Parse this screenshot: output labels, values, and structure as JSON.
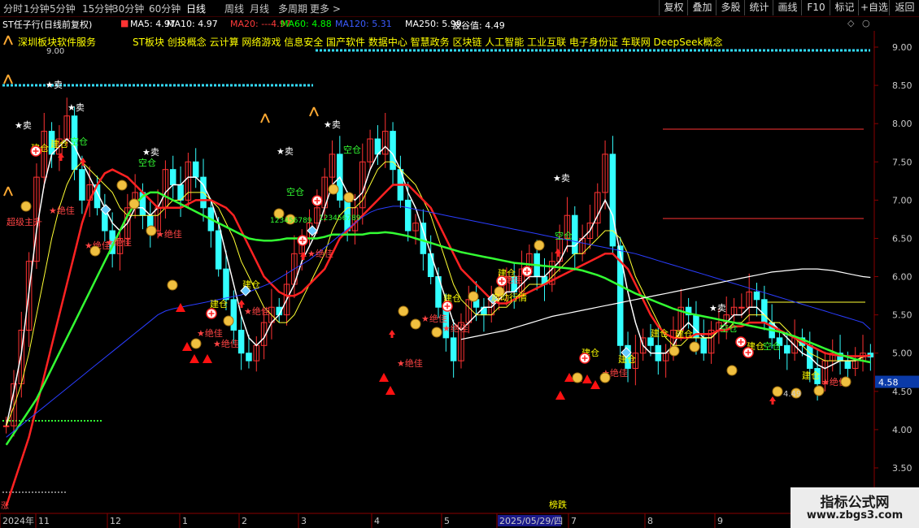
{
  "periods": [
    "分时",
    "1分钟",
    "5分钟",
    "15分钟",
    "30分钟",
    "60分钟",
    "日线",
    "周线",
    "月线",
    "多周期",
    "更多 >"
  ],
  "active_period": "日线",
  "right_buttons": [
    "复权",
    "叠加",
    "多股",
    "统计",
    "画线",
    "F10",
    "标记",
    "+自选",
    "返回"
  ],
  "stock_title": "ST任子行(日线前复权)",
  "ma_items": [
    {
      "label": "MA5: 4.97",
      "color": "#ffffff"
    },
    {
      "label": "MA10: 4.97",
      "color": "#ffffff"
    },
    {
      "label": "MA20: ---4.97",
      "color": "#ff3b3b"
    },
    {
      "label": "MA60: 4.88",
      "color": "#00ff00"
    },
    {
      "label": "MA120: 5.31",
      "color": "#3a5bff"
    },
    {
      "label": "MA250: 5.99",
      "color": "#ffffff"
    },
    {
      "label": "波谷值: 4.49",
      "color": "#ffffff"
    }
  ],
  "concept_left": "深圳板块软件服务",
  "concept_right": "ST板块 创投概念 云计算 网络游戏 信息安全 国产软件 数据中心 智慧政务 区块链 人工智能 工业互联 电子身份证 车联网 DeepSeek概念",
  "annotations": {
    "sell": "卖",
    "build": "建仓",
    "empty": "空仓",
    "best": "绝佳",
    "main_rise": "超级主升",
    "start": "启动行情",
    "bottom_value": "4.49",
    "top_value": "9.00",
    "digits": "123456789",
    "bang": "榜跌",
    "zhang": "涨"
  },
  "price_axis": {
    "ticks": [
      "9.00",
      "8.50",
      "8.00",
      "7.50",
      "7.00",
      "6.50",
      "6.00",
      "5.50",
      "5.00",
      "4.50",
      "4.00",
      "3.50"
    ],
    "current": "4.58"
  },
  "date_axis": [
    "2024年",
    "11",
    "12",
    "1",
    "2",
    "3",
    "4",
    "5",
    "2025/05/29/四",
    "7",
    "8",
    "9"
  ],
  "watermark": {
    "title": "指标公式网",
    "url": "www.zbgs3.com"
  },
  "colors": {
    "up": "#ff3333",
    "down": "#33ffff",
    "ma5": "#ffffff",
    "ma10": "#ffff33",
    "ma20": "#ff2222",
    "ma60": "#33ff33",
    "ma120": "#3344ff",
    "ma250": "#ffffff"
  },
  "chart_data": {
    "type": "candlestick",
    "ylim": [
      3.3,
      9.3
    ],
    "close": [
      4.05,
      4.6,
      5.3,
      6.2,
      7.3,
      7.9,
      7.6,
      7.8,
      8.1,
      7.4,
      7.0,
      7.2,
      6.9,
      6.6,
      6.3,
      6.5,
      6.9,
      7.1,
      6.8,
      6.6,
      6.9,
      7.4,
      7.2,
      7.0,
      7.5,
      7.3,
      6.9,
      6.6,
      6.1,
      5.7,
      5.3,
      5.0,
      4.9,
      5.1,
      5.4,
      5.6,
      5.5,
      5.9,
      6.3,
      6.5,
      6.7,
      6.9,
      7.3,
      7.6,
      7.0,
      6.6,
      6.9,
      7.5,
      7.8,
      7.6,
      7.9,
      7.4,
      7.0,
      6.6,
      6.7,
      6.3,
      6.0,
      5.6,
      5.2,
      4.9,
      5.4,
      5.7,
      5.6,
      5.5,
      5.7,
      5.8,
      6.0,
      5.8,
      6.1,
      6.3,
      6.0,
      5.9,
      6.2,
      6.5,
      6.8,
      6.3,
      6.5,
      6.7,
      7.1,
      7.6,
      6.4,
      5.1,
      4.8,
      5.0,
      5.2,
      5.1,
      4.9,
      5.0,
      5.3,
      5.6,
      5.5,
      5.2,
      5.0,
      5.3,
      5.4,
      5.5,
      5.6,
      5.6,
      5.8,
      5.7,
      5.4,
      5.2,
      5.1,
      5.0,
      5.2,
      5.1,
      4.8,
      4.6,
      4.9,
      5.0,
      4.9,
      4.8,
      4.9,
      5.0,
      4.95
    ],
    "series": [
      {
        "name": "MA5",
        "values": [
          4.05,
          4.5,
          5.0,
          5.8,
          6.6,
          7.2,
          7.6,
          7.7,
          7.8,
          7.7,
          7.5,
          7.3,
          7.1,
          6.9,
          6.7,
          6.6,
          6.7,
          6.9,
          6.9,
          6.8,
          6.9,
          7.1,
          7.2,
          7.2,
          7.3,
          7.3,
          7.2,
          7.0,
          6.7,
          6.3,
          5.9,
          5.5,
          5.2,
          5.1,
          5.2,
          5.4,
          5.5,
          5.7,
          5.9,
          6.2,
          6.4,
          6.6,
          6.9,
          7.2,
          7.3,
          7.1,
          7.0,
          7.1,
          7.4,
          7.6,
          7.7,
          7.6,
          7.4,
          7.1,
          6.9,
          6.6,
          6.3,
          6.0,
          5.7,
          5.4,
          5.3,
          5.4,
          5.5,
          5.6,
          5.6,
          5.7,
          5.8,
          5.8,
          5.9,
          6.0,
          6.0,
          6.0,
          6.1,
          6.2,
          6.4,
          6.4,
          6.5,
          6.6,
          6.8,
          7.0,
          6.8,
          6.3,
          5.8,
          5.4,
          5.1,
          5.0,
          5.0,
          5.0,
          5.1,
          5.3,
          5.4,
          5.3,
          5.2,
          5.2,
          5.3,
          5.4,
          5.5,
          5.5,
          5.6,
          5.6,
          5.5,
          5.4,
          5.3,
          5.2,
          5.1,
          5.0,
          4.95,
          4.85,
          4.8,
          4.85,
          4.9,
          4.9,
          4.9,
          4.95,
          4.97
        ]
      },
      {
        "name": "MA10",
        "values": [
          4.05,
          4.3,
          4.6,
          5.0,
          5.5,
          6.0,
          6.5,
          6.9,
          7.2,
          7.4,
          7.5,
          7.4,
          7.3,
          7.2,
          7.1,
          6.9,
          6.8,
          6.8,
          6.8,
          6.8,
          6.8,
          6.9,
          7.0,
          7.0,
          7.1,
          7.1,
          7.1,
          7.0,
          6.9,
          6.7,
          6.5,
          6.2,
          6.0,
          5.8,
          5.6,
          5.5,
          5.4,
          5.4,
          5.5,
          5.7,
          5.9,
          6.1,
          6.3,
          6.6,
          6.8,
          6.9,
          6.9,
          7.0,
          7.2,
          7.4,
          7.5,
          7.5,
          7.4,
          7.3,
          7.2,
          7.0,
          6.8,
          6.5,
          6.2,
          5.9,
          5.7,
          5.6,
          5.5,
          5.5,
          5.5,
          5.6,
          5.6,
          5.7,
          5.8,
          5.9,
          5.9,
          5.9,
          6.0,
          6.1,
          6.2,
          6.3,
          6.3,
          6.4,
          6.5,
          6.6,
          6.6,
          6.5,
          6.3,
          6.0,
          5.8,
          5.6,
          5.4,
          5.2,
          5.1,
          5.1,
          5.2,
          5.2,
          5.2,
          5.2,
          5.3,
          5.3,
          5.4,
          5.4,
          5.5,
          5.5,
          5.5,
          5.4,
          5.4,
          5.3,
          5.2,
          5.1,
          5.0,
          4.95,
          4.9,
          4.9,
          4.9,
          4.9,
          4.9,
          4.95,
          4.97
        ]
      },
      {
        "name": "MA20",
        "values": [
          3.0,
          3.3,
          3.6,
          3.9,
          4.3,
          4.7,
          5.1,
          5.5,
          5.9,
          6.3,
          6.7,
          7.0,
          7.2,
          7.35,
          7.4,
          7.35,
          7.3,
          7.2,
          7.1,
          7.0,
          6.9,
          6.9,
          6.9,
          6.9,
          6.95,
          7.0,
          7.0,
          7.0,
          6.95,
          6.9,
          6.8,
          6.6,
          6.4,
          6.2,
          6.0,
          5.9,
          5.8,
          5.75,
          5.75,
          5.8,
          5.9,
          6.0,
          6.1,
          6.3,
          6.5,
          6.6,
          6.7,
          6.8,
          6.9,
          7.0,
          7.1,
          7.2,
          7.2,
          7.2,
          7.1,
          7.0,
          6.9,
          6.7,
          6.5,
          6.3,
          6.1,
          6.0,
          5.9,
          5.8,
          5.7,
          5.65,
          5.65,
          5.7,
          5.75,
          5.8,
          5.85,
          5.9,
          5.95,
          6.0,
          6.05,
          6.1,
          6.15,
          6.2,
          6.25,
          6.3,
          6.3,
          6.2,
          6.1,
          5.9,
          5.7,
          5.5,
          5.35,
          5.25,
          5.2,
          5.2,
          5.2,
          5.25,
          5.25,
          5.25,
          5.3,
          5.3,
          5.35,
          5.35,
          5.4,
          5.4,
          5.4,
          5.35,
          5.3,
          5.25,
          5.2,
          5.15,
          5.1,
          5.05,
          5.0,
          4.98,
          4.97,
          4.96,
          4.96,
          4.96,
          4.97
        ]
      },
      {
        "name": "MA60",
        "values": [
          3.8,
          3.95,
          4.1,
          4.25,
          4.4,
          4.6,
          4.8,
          5.0,
          5.2,
          5.4,
          5.6,
          5.8,
          6.0,
          6.2,
          6.4,
          6.6,
          6.8,
          6.95,
          7.05,
          7.1,
          7.1,
          7.05,
          7.0,
          6.95,
          6.9,
          6.85,
          6.8,
          6.75,
          6.7,
          6.65,
          6.6,
          6.55,
          6.5,
          6.48,
          6.47,
          6.47,
          6.48,
          6.5,
          6.5,
          6.5,
          6.5,
          6.5,
          6.52,
          6.55,
          6.55,
          6.55,
          6.55,
          6.55,
          6.57,
          6.57,
          6.58,
          6.57,
          6.55,
          6.53,
          6.5,
          6.47,
          6.44,
          6.41,
          6.38,
          6.35,
          6.32,
          6.3,
          6.28,
          6.26,
          6.24,
          6.22,
          6.2,
          6.18,
          6.17,
          6.16,
          6.15,
          6.14,
          6.13,
          6.12,
          6.11,
          6.1,
          6.08,
          6.05,
          6.02,
          5.98,
          5.93,
          5.88,
          5.83,
          5.78,
          5.74,
          5.7,
          5.66,
          5.62,
          5.58,
          5.55,
          5.52,
          5.5,
          5.48,
          5.46,
          5.44,
          5.42,
          5.4,
          5.38,
          5.36,
          5.34,
          5.32,
          5.3,
          5.28,
          5.25,
          5.22,
          5.18,
          5.14,
          5.1,
          5.06,
          5.02,
          4.98,
          4.95,
          4.92,
          4.9,
          4.88
        ]
      },
      {
        "name": "MA120",
        "values": [
          3.9,
          3.98,
          4.06,
          4.14,
          4.22,
          4.3,
          4.38,
          4.46,
          4.54,
          4.62,
          4.7,
          4.78,
          4.86,
          4.94,
          5.02,
          5.1,
          5.18,
          5.26,
          5.34,
          5.42,
          5.5,
          5.55,
          5.58,
          5.6,
          5.62,
          5.64,
          5.66,
          5.68,
          5.7,
          5.72,
          5.74,
          5.76,
          5.8,
          5.84,
          5.88,
          5.92,
          5.98,
          6.04,
          6.1,
          6.16,
          6.22,
          6.3,
          6.38,
          6.46,
          6.54,
          6.62,
          6.7,
          6.78,
          6.84,
          6.88,
          6.9,
          6.92,
          6.92,
          6.9,
          6.88,
          6.86,
          6.84,
          6.82,
          6.8,
          6.78,
          6.76,
          6.74,
          6.72,
          6.7,
          6.68,
          6.66,
          6.64,
          6.62,
          6.6,
          6.58,
          6.56,
          6.54,
          6.52,
          6.5,
          6.48,
          6.46,
          6.44,
          6.42,
          6.4,
          6.38,
          6.36,
          6.34,
          6.32,
          6.3,
          6.27,
          6.24,
          6.21,
          6.18,
          6.15,
          6.12,
          6.09,
          6.06,
          6.03,
          6.0,
          5.97,
          5.94,
          5.91,
          5.88,
          5.85,
          5.82,
          5.79,
          5.76,
          5.73,
          5.7,
          5.67,
          5.64,
          5.61,
          5.58,
          5.55,
          5.52,
          5.49,
          5.46,
          5.43,
          5.4,
          5.31
        ]
      },
      {
        "name": "MA250",
        "values": [
          null,
          null,
          null,
          null,
          null,
          null,
          null,
          null,
          null,
          null,
          null,
          null,
          null,
          null,
          null,
          null,
          null,
          null,
          null,
          null,
          null,
          null,
          null,
          null,
          null,
          null,
          null,
          null,
          null,
          null,
          null,
          null,
          null,
          null,
          null,
          null,
          null,
          null,
          null,
          null,
          null,
          null,
          null,
          null,
          null,
          null,
          null,
          null,
          null,
          null,
          null,
          null,
          null,
          null,
          null,
          null,
          null,
          null,
          null,
          null,
          5.18,
          5.2,
          5.22,
          5.24,
          5.26,
          5.28,
          5.3,
          5.33,
          5.36,
          5.39,
          5.42,
          5.45,
          5.48,
          5.5,
          5.52,
          5.54,
          5.56,
          5.58,
          5.6,
          5.62,
          5.64,
          5.66,
          5.68,
          5.7,
          5.72,
          5.74,
          5.76,
          5.78,
          5.8,
          5.82,
          5.84,
          5.86,
          5.88,
          5.9,
          5.92,
          5.94,
          5.96,
          5.98,
          6.0,
          6.02,
          6.04,
          6.06,
          6.07,
          6.08,
          6.09,
          6.1,
          6.1,
          6.1,
          6.09,
          6.08,
          6.06,
          6.04,
          6.02,
          6.0,
          5.99
        ]
      }
    ]
  }
}
